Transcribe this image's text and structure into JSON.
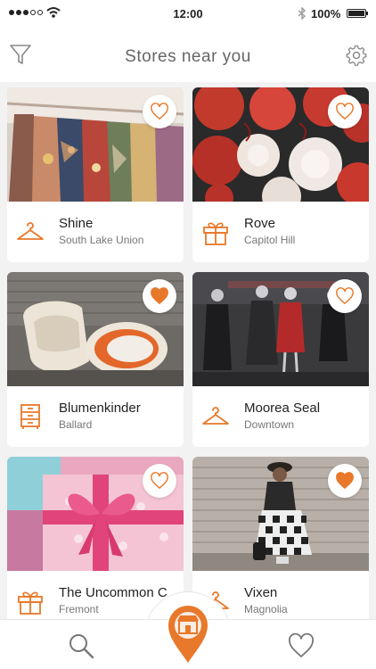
{
  "status_bar": {
    "time": "12:00",
    "battery": "100%"
  },
  "header": {
    "title": "Stores near you"
  },
  "stores": [
    {
      "name": "Shine",
      "area": "South Lake Union",
      "favorited": false,
      "icon": "hanger-icon"
    },
    {
      "name": "Rove",
      "area": "Capitol Hill",
      "favorited": false,
      "icon": "gift-icon"
    },
    {
      "name": "Blumenkinder",
      "area": "Ballard",
      "favorited": true,
      "icon": "dresser-icon"
    },
    {
      "name": "Moorea Seal",
      "area": "Downtown",
      "favorited": false,
      "icon": "hanger-icon"
    },
    {
      "name": "The Uncommon C",
      "area": "Fremont",
      "favorited": false,
      "icon": "gift-icon"
    },
    {
      "name": "Vixen",
      "area": "Magnolia",
      "favorited": true,
      "icon": "hanger-icon"
    }
  ],
  "colors": {
    "accent": "#E8782A",
    "title": "#666666",
    "background": "#F2F2F2"
  },
  "nav": {
    "items": [
      "search-icon",
      "store-location-icon",
      "heart-icon"
    ]
  }
}
